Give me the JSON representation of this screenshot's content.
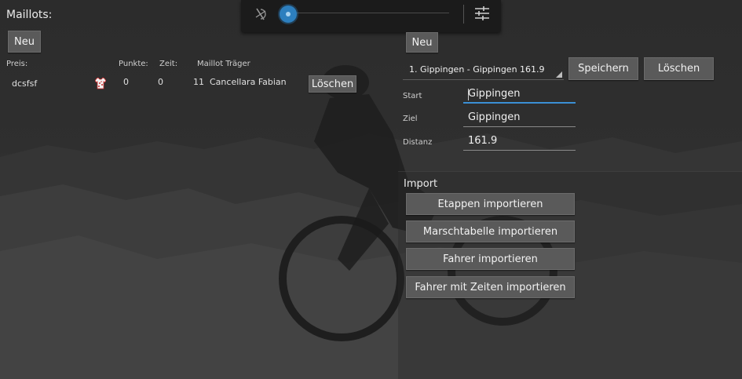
{
  "left": {
    "title": "Maillots:",
    "new_button": "Neu",
    "headers": {
      "price": "Preis:",
      "points": "Punkte:",
      "time": "Zeit:",
      "carrier": "Maillot Träger"
    },
    "rows": [
      {
        "price": "dcsfsf",
        "points": "0",
        "time": "0",
        "carrier_number": "11",
        "carrier_name": "Cancellara Fabian",
        "delete_label": "Löschen"
      }
    ]
  },
  "right": {
    "new_button": "Neu",
    "stage_select": "1. Gippingen - Gippingen 161.9",
    "save_button": "Speichern",
    "delete_button": "Löschen",
    "start_label": "Start",
    "start_value": "Gippingen",
    "goal_label": "Ziel",
    "goal_value": "Gippingen",
    "distance_label": "Distanz",
    "distance_value": "161.9",
    "import_title": "Import",
    "import_buttons": [
      "Etappen importieren",
      "Marschtabelle importieren",
      "Fahrer importieren",
      "Fahrer mit Zeiten importieren"
    ]
  },
  "topbar": {
    "brightness_level": 0.0
  },
  "icons": {
    "auto_brightness": "auto-brightness-off-icon",
    "settings": "settings-sliders-icon",
    "jersey": "jersey-icon"
  },
  "colors": {
    "accent": "#3b8fd4",
    "button_bg": "#5a5a5a",
    "knob": "#2d7fbe"
  }
}
